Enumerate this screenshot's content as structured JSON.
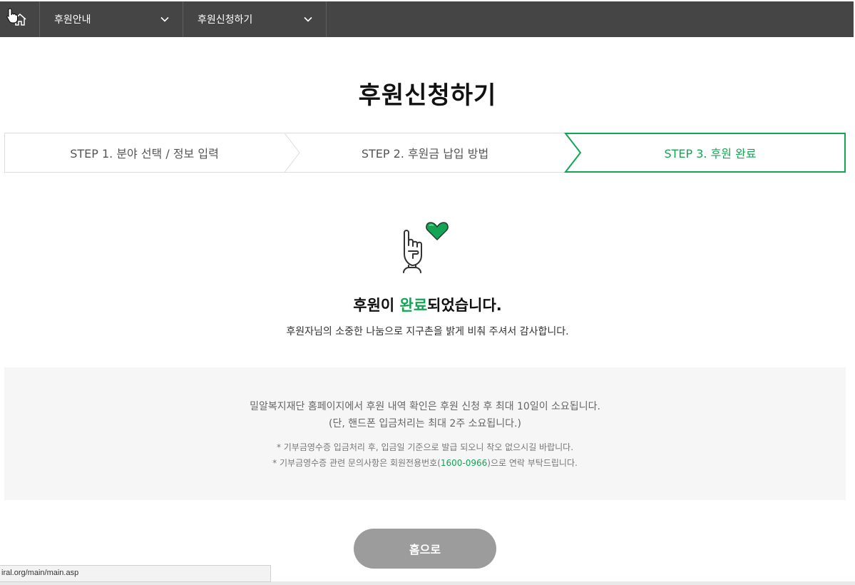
{
  "nav": {
    "home_icon": "home-icon",
    "menu1": "후원안내",
    "menu2": "후원신청하기"
  },
  "page_title": "후원신청하기",
  "steps": [
    {
      "label": "STEP 1. 분야 선택 / 정보 입력",
      "active": false
    },
    {
      "label": "STEP 2. 후원금 납입 방법",
      "active": false
    },
    {
      "label": "STEP 3. 후원 완료",
      "active": true
    }
  ],
  "completion": {
    "heading_pre": "후원이 ",
    "heading_highlight": "완료",
    "heading_post": "되었습니다.",
    "subtitle": "후원자님의 소중한 나눔으로 지구촌을 밝게 비춰 주셔서 감사합니다."
  },
  "info": {
    "line1": "밀알복지재단 홈페이지에서 후원 내역 확인은 후원 신청 후 최대 10일이 소요됩니다.",
    "line2": "(단, 핸드폰 입금처리는 최대 2주 소요됩니다.)",
    "note1": "* 기부금영수증 입금처리 후, 입금일 기준으로 발급 되오니 착오 없으시길 바랍니다.",
    "note2_pre": "* 기부금영수증 관련 문의사항은 회원전용번호(",
    "note2_phone": "1600-0966",
    "note2_post": ")으로 연락 부탁드립니다."
  },
  "home_button": "홈으로",
  "status_url": "iral.org/main/main.asp",
  "colors": {
    "accent": "#13a554",
    "nav_bg": "#454545",
    "button_bg": "#9c9c9c",
    "info_bg": "#f6f6f6"
  }
}
